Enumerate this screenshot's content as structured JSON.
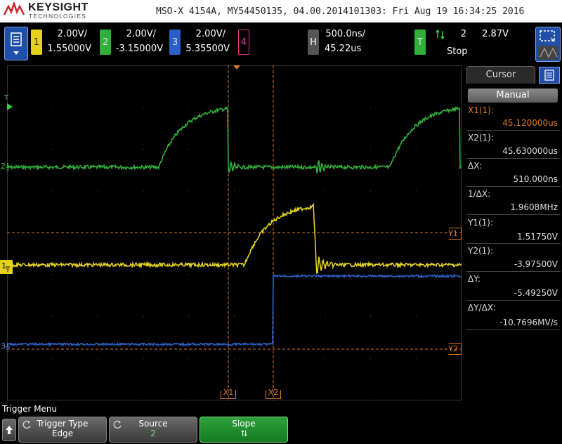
{
  "brand": {
    "name": "KEYSIGHT",
    "sub": "TECHNOLOGIES"
  },
  "header": {
    "info": "MSO-X 4154A, MY54450135, 04.00.2014101303: Fri Aug 19 16:34:25 2016"
  },
  "channels": [
    {
      "id": "1",
      "scale": "2.00V/",
      "offset": "1.55000V",
      "color": "#e3d21a"
    },
    {
      "id": "2",
      "scale": "2.00V/",
      "offset": "-3.15000V",
      "color": "#30b03a"
    },
    {
      "id": "3",
      "scale": "2.00V/",
      "offset": "5.35500V",
      "color": "#2a61c9"
    },
    {
      "id": "4",
      "scale": "",
      "offset": "",
      "color": "#e0359a"
    }
  ],
  "horizontal": {
    "label": "H",
    "timebase": "500.0ns/",
    "delay": "45.22us"
  },
  "trigger": {
    "label": "T",
    "source": "2",
    "level": "2.87V",
    "status": "Stop"
  },
  "markers": {
    "x1": "X1",
    "x2": "X2",
    "y1": "Y1",
    "y2": "Y2",
    "trigger_mark": "T",
    "ch1": "1",
    "ch2": "2",
    "ch3": "3"
  },
  "cursor_panel": {
    "title": "Cursor",
    "mode": "Manual",
    "x1_label": "X1(1):",
    "x1_value": "45.120000us",
    "x2_label": "X2(1):",
    "x2_value": "45.630000us",
    "dx_label": "ΔX:",
    "dx_value": "510.000ns",
    "inv_dx_label": "1/ΔX:",
    "inv_dx_value": "1.9608MHz",
    "y1_label": "Y1(1):",
    "y1_value": "1.51750V",
    "y2_label": "Y2(1):",
    "y2_value": "-3.97500V",
    "dy_label": "ΔY:",
    "dy_value": "-5.49250V",
    "dydx_label": "ΔY/ΔX:",
    "dydx_value": "-10.7696MV/s"
  },
  "softmenu": {
    "title": "Trigger Menu",
    "keys": [
      {
        "label": "Trigger Type",
        "value": "Edge"
      },
      {
        "label": "Source",
        "value": "2"
      },
      {
        "label": "Slope",
        "value": "⮁"
      }
    ]
  },
  "colors": {
    "ch1": "#e3d21a",
    "ch2": "#30b03a",
    "ch3": "#2a61c9",
    "cursor": "#e07a20"
  }
}
